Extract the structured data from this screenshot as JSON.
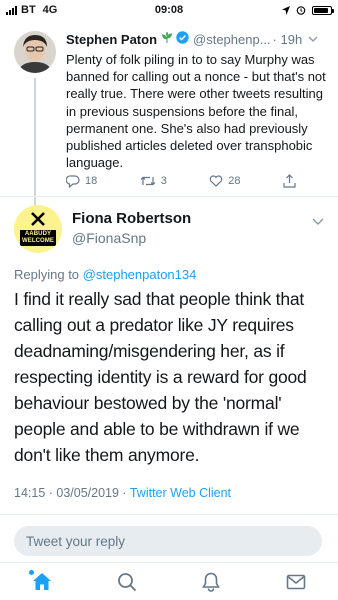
{
  "status_bar": {
    "carrier": "BT",
    "network": "4G",
    "time": "09:08"
  },
  "parent_tweet": {
    "name": "Stephen Paton",
    "handle": "@stephenp...",
    "time": "· 19h",
    "text": "Plenty of folk piling in to to say Murphy was banned for calling out a nonce - but that's not really true. There were other tweets resulting in previous suspensions before the final, permanent one. She's also had previously published articles deleted over transphobic language.",
    "replies": "18",
    "retweets": "3",
    "likes": "28"
  },
  "main_tweet": {
    "name": "Fiona Robertson",
    "handle": "@FionaSnp",
    "avatar_badge_line1": "AABUDY",
    "avatar_badge_line2": "WELCOME",
    "replying_prefix": "Replying to",
    "replying_handle": "@stephenpaton134",
    "text": "I find it really sad that people think that calling out a predator like JY requires deadnaming/misgendering her, as if respecting identity is a reward for good behaviour bestowed by the 'normal' people and able to be withdrawn if we don't like them anymore.",
    "timestamp": "14:15 · 03/05/2019 · ",
    "client": "Twitter Web Client"
  },
  "reply_box": {
    "placeholder": "Tweet your reply"
  },
  "tab_bar": {
    "items": [
      "home-icon",
      "search-icon",
      "notifications-icon",
      "messages-icon"
    ]
  },
  "colors": {
    "accent": "#1da1f2",
    "muted": "#657786",
    "divider": "#e6ecf0",
    "snp_yellow": "#fdf38e"
  }
}
